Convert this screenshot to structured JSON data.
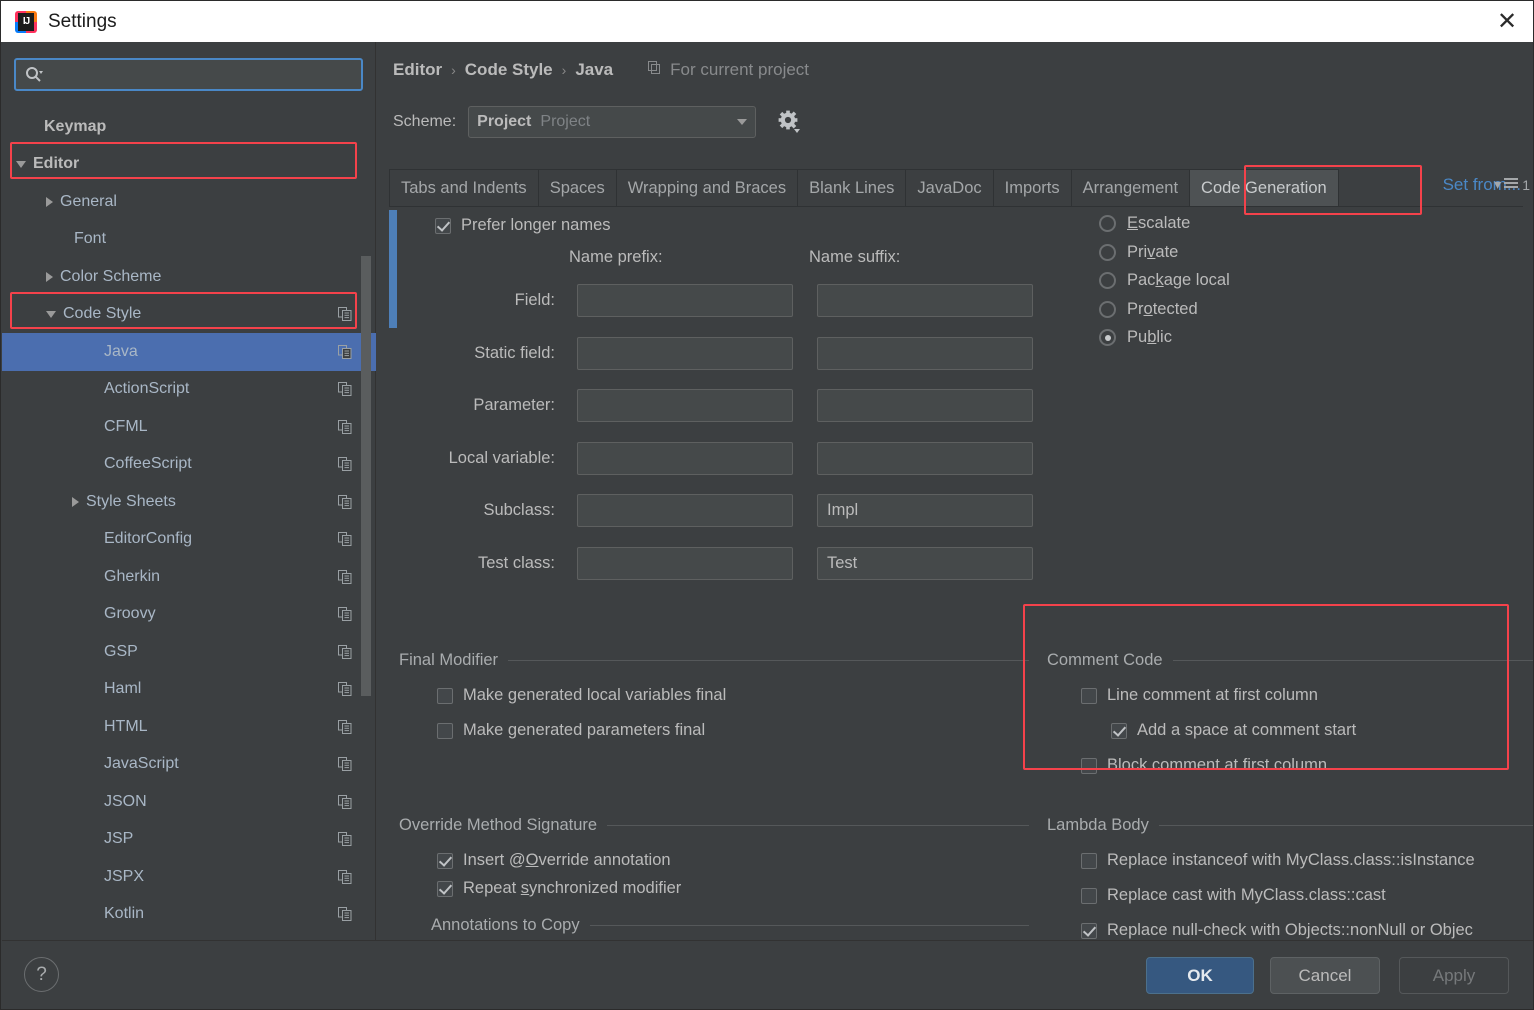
{
  "window": {
    "title": "Settings",
    "logo_icon": "intellij-idea-logo",
    "close_icon": "close-icon"
  },
  "sidebar": {
    "search": {
      "placeholder": "",
      "value": "",
      "icon": "search-icon"
    },
    "items": [
      {
        "label": "Keymap",
        "arrow": "none",
        "indent": 28,
        "bold": true,
        "copy": false,
        "selected": false
      },
      {
        "label": "Editor",
        "arrow": "open",
        "indent": 14,
        "bold": true,
        "copy": false,
        "selected": false
      },
      {
        "label": "General",
        "arrow": "closed",
        "indent": 44,
        "bold": false,
        "copy": false,
        "selected": false
      },
      {
        "label": "Font",
        "arrow": "none",
        "indent": 58,
        "bold": false,
        "copy": false,
        "selected": false
      },
      {
        "label": "Color Scheme",
        "arrow": "closed",
        "indent": 44,
        "bold": false,
        "copy": false,
        "selected": false
      },
      {
        "label": "Code Style",
        "arrow": "open",
        "indent": 44,
        "bold": false,
        "copy": true,
        "selected": false
      },
      {
        "label": "Java",
        "arrow": "none",
        "indent": 88,
        "bold": false,
        "copy": true,
        "selected": true
      },
      {
        "label": "ActionScript",
        "arrow": "none",
        "indent": 88,
        "bold": false,
        "copy": true,
        "selected": false
      },
      {
        "label": "CFML",
        "arrow": "none",
        "indent": 88,
        "bold": false,
        "copy": true,
        "selected": false
      },
      {
        "label": "CoffeeScript",
        "arrow": "none",
        "indent": 88,
        "bold": false,
        "copy": true,
        "selected": false
      },
      {
        "label": "Style Sheets",
        "arrow": "closed",
        "indent": 70,
        "bold": false,
        "copy": true,
        "selected": false
      },
      {
        "label": "EditorConfig",
        "arrow": "none",
        "indent": 88,
        "bold": false,
        "copy": true,
        "selected": false
      },
      {
        "label": "Gherkin",
        "arrow": "none",
        "indent": 88,
        "bold": false,
        "copy": true,
        "selected": false
      },
      {
        "label": "Groovy",
        "arrow": "none",
        "indent": 88,
        "bold": false,
        "copy": true,
        "selected": false
      },
      {
        "label": "GSP",
        "arrow": "none",
        "indent": 88,
        "bold": false,
        "copy": true,
        "selected": false
      },
      {
        "label": "Haml",
        "arrow": "none",
        "indent": 88,
        "bold": false,
        "copy": true,
        "selected": false
      },
      {
        "label": "HTML",
        "arrow": "none",
        "indent": 88,
        "bold": false,
        "copy": true,
        "selected": false
      },
      {
        "label": "JavaScript",
        "arrow": "none",
        "indent": 88,
        "bold": false,
        "copy": true,
        "selected": false
      },
      {
        "label": "JSON",
        "arrow": "none",
        "indent": 88,
        "bold": false,
        "copy": true,
        "selected": false
      },
      {
        "label": "JSP",
        "arrow": "none",
        "indent": 88,
        "bold": false,
        "copy": true,
        "selected": false
      },
      {
        "label": "JSPX",
        "arrow": "none",
        "indent": 88,
        "bold": false,
        "copy": true,
        "selected": false
      },
      {
        "label": "Kotlin",
        "arrow": "none",
        "indent": 88,
        "bold": false,
        "copy": true,
        "selected": false
      }
    ]
  },
  "header": {
    "breadcrumb": [
      "Editor",
      "Code Style",
      "Java"
    ],
    "breadcrumb_separator": "›",
    "for_current_project": "For current project",
    "for_current_project_icon": "copy-scope-icon",
    "scheme_label": "Scheme:",
    "scheme_value": "Project",
    "scheme_sub": "Project",
    "scheme_caret_icon": "chevron-down-icon",
    "gear_icon": "gear-icon",
    "set_from_link": "Set from..."
  },
  "tabs": {
    "items": [
      {
        "label": "Tabs and Indents",
        "active": false
      },
      {
        "label": "Spaces",
        "active": false
      },
      {
        "label": "Wrapping and Braces",
        "active": false
      },
      {
        "label": "Blank Lines",
        "active": false
      },
      {
        "label": "JavaDoc",
        "active": false
      },
      {
        "label": "Imports",
        "active": false
      },
      {
        "label": "Arrangement",
        "active": false
      },
      {
        "label": "Code Generation",
        "active": true
      }
    ],
    "overflow_count": "1",
    "overflow_icon": "tab-list-icon"
  },
  "content": {
    "prefer_longer_names": {
      "label": "Prefer longer names",
      "checked": true
    },
    "naming": {
      "prefix_header": "Name prefix:",
      "suffix_header": "Name suffix:",
      "rows": [
        {
          "label": "Field:",
          "prefix": "",
          "suffix": ""
        },
        {
          "label": "Static field:",
          "prefix": "",
          "suffix": ""
        },
        {
          "label": "Parameter:",
          "prefix": "",
          "suffix": ""
        },
        {
          "label": "Local variable:",
          "prefix": "",
          "suffix": ""
        },
        {
          "label": "Subclass:",
          "prefix": "",
          "suffix": "Impl"
        },
        {
          "label": "Test class:",
          "prefix": "",
          "suffix": "Test"
        }
      ]
    },
    "visibility": {
      "options": [
        {
          "label": "Escalate",
          "mnemonic_at": 0,
          "selected": false
        },
        {
          "label": "Private",
          "mnemonic_at": 3,
          "selected": false
        },
        {
          "label": "Package local",
          "mnemonic_at": 3,
          "selected": false
        },
        {
          "label": "Protected",
          "mnemonic_at": 2,
          "selected": false
        },
        {
          "label": "Public",
          "mnemonic_at": 2,
          "selected": true
        }
      ]
    },
    "final_modifier": {
      "title": "Final Modifier",
      "options": [
        {
          "label": "Make generated local variables final",
          "checked": false
        },
        {
          "label": "Make generated parameters final",
          "checked": false
        }
      ]
    },
    "comment_code": {
      "title": "Comment Code",
      "options": [
        {
          "label": "Line comment at first column",
          "checked": false,
          "indent": 0
        },
        {
          "label": "Add a space at comment start",
          "checked": true,
          "indent": 30
        },
        {
          "label": "Block comment at first column",
          "checked": false,
          "indent": 0
        }
      ]
    },
    "override_method_signature": {
      "title": "Override Method Signature",
      "options": [
        {
          "label": "Insert @Override annotation",
          "checked": true,
          "mnemonic_at": 8
        },
        {
          "label": "Repeat synchronized modifier",
          "checked": true,
          "mnemonic_at": 7
        }
      ],
      "annotations_title": "Annotations to Copy",
      "add_button_icon": "plus-icon"
    },
    "lambda_body": {
      "title": "Lambda Body",
      "options": [
        {
          "label": "Replace instanceof with MyClass.class::isInstance",
          "checked": false
        },
        {
          "label": "Replace cast with MyClass.class::cast",
          "checked": false
        },
        {
          "label": "Replace null-check with Objects::nonNull or Objec",
          "checked": true
        }
      ]
    }
  },
  "footer": {
    "help_label": "?",
    "ok_label": "OK",
    "cancel_label": "Cancel",
    "apply_label": "Apply"
  },
  "colors": {
    "accent": "#4b6eaf",
    "highlight_box": "#f4424b",
    "link": "#4a88c7",
    "bg": "#3c3f41",
    "text": "#bbbbbb"
  }
}
